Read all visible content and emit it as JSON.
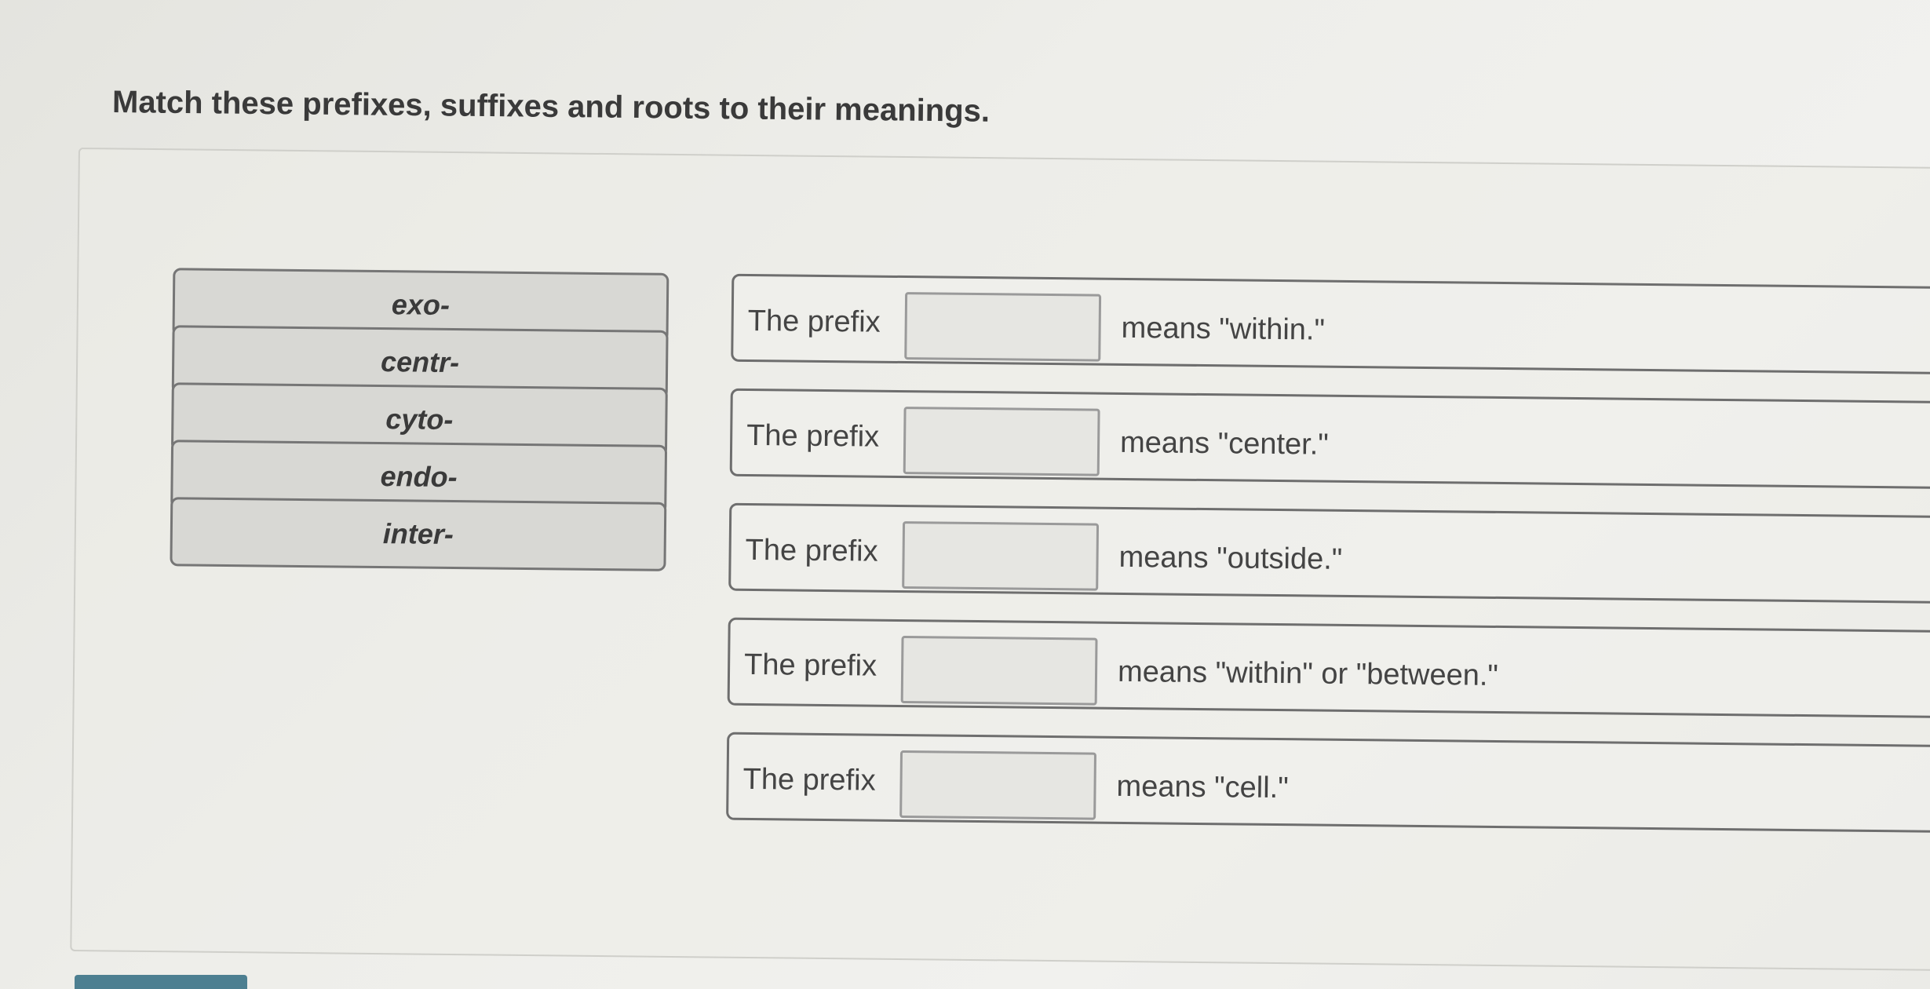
{
  "question": {
    "title": "Match these prefixes, suffixes and roots to their meanings."
  },
  "tiles": [
    {
      "label": "exo-"
    },
    {
      "label": "centr-"
    },
    {
      "label": "cyto-"
    },
    {
      "label": "endo-"
    },
    {
      "label": "inter-"
    }
  ],
  "rows": [
    {
      "prefix_text": "The prefix",
      "meaning": "means \"within.\""
    },
    {
      "prefix_text": "The prefix",
      "meaning": "means \"center.\""
    },
    {
      "prefix_text": "The prefix",
      "meaning": "means \"outside.\""
    },
    {
      "prefix_text": "The prefix",
      "meaning": "means \"within\" or \"between.\""
    },
    {
      "prefix_text": "The prefix",
      "meaning": "means \"cell.\""
    }
  ],
  "colors": {
    "tile_background": "#d8d8d4",
    "border": "#6e6e6e",
    "submit_button": "#4d7f91"
  }
}
